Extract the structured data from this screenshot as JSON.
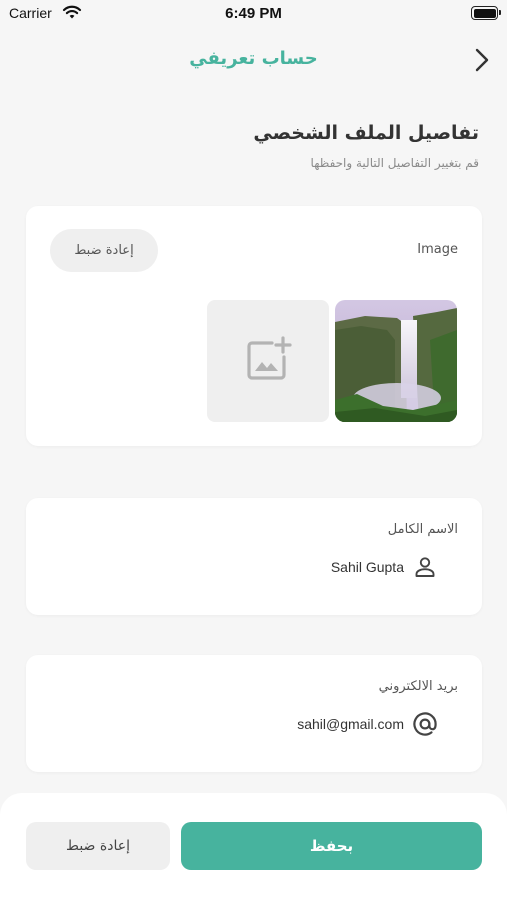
{
  "status_bar": {
    "carrier": "Carrier",
    "time": "6:49 PM"
  },
  "nav": {
    "title": "حساب تعريفي",
    "back_icon": "chevron-right-icon"
  },
  "header": {
    "title": "تفاصيل الملف الشخصي",
    "subtitle": "قم بتغيير التفاصيل التالية واحفظها"
  },
  "image_card": {
    "label": "Image",
    "reset_label": "إعادة ضبط",
    "add_icon": "add-photo-icon"
  },
  "name_card": {
    "label": "الاسم الكامل",
    "value": "Sahil Gupta",
    "icon": "person-icon"
  },
  "email_card": {
    "label": "بريد الالكتروني",
    "value": "sahil@gmail.com",
    "icon": "at-icon"
  },
  "actions": {
    "save_label": "بحفظ",
    "reset_label": "إعادة ضبط"
  },
  "colors": {
    "accent": "#47b39e",
    "background": "#f6f6f6",
    "card": "#ffffff",
    "neutral_button": "#efefef"
  }
}
